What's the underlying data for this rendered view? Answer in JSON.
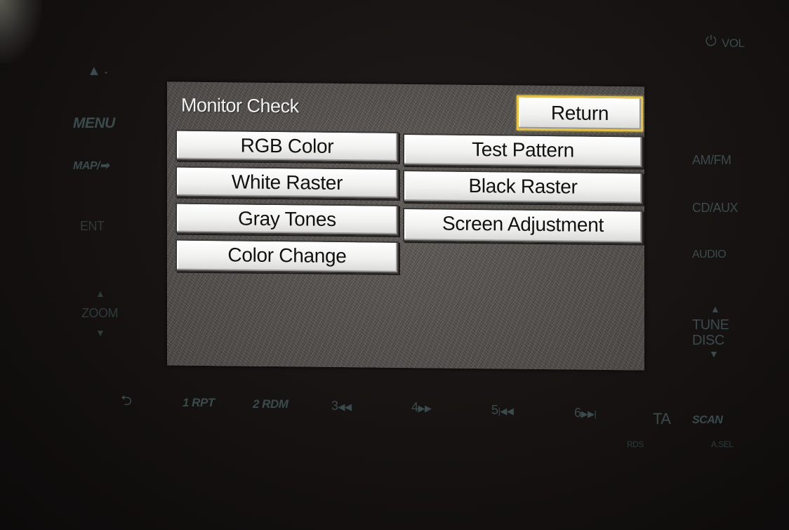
{
  "head_unit": {
    "vol_label": "VOL",
    "left_controls": {
      "eject": "▲",
      "menu": "MENU",
      "map": "MAP/",
      "ent": "ENT",
      "zoom": "ZOOM"
    },
    "right_controls": {
      "am_fm": "AM/FM",
      "cd_aux": "CD/AUX",
      "audio": "AUDIO",
      "tune": "TUNE",
      "disc": "DISC"
    },
    "presets": [
      "1 RPT",
      "2 RDM",
      "3",
      "4",
      "5",
      "6"
    ],
    "ta": "TA",
    "rds": "RDS",
    "scan": "SCAN",
    "a_sel": "A.SEL"
  },
  "screen": {
    "title": "Monitor Check",
    "return_label": "Return",
    "buttons": {
      "rgb_color": "RGB Color",
      "test_pattern": "Test Pattern",
      "white_raster": "White Raster",
      "black_raster": "Black Raster",
      "gray_tones": "Gray Tones",
      "screen_adjustment": "Screen Adjustment",
      "color_change": "Color Change"
    }
  },
  "colors": {
    "selection_highlight": "#e5c24a",
    "button_face": "#f1f1f0",
    "screen_background": "#55524f"
  }
}
